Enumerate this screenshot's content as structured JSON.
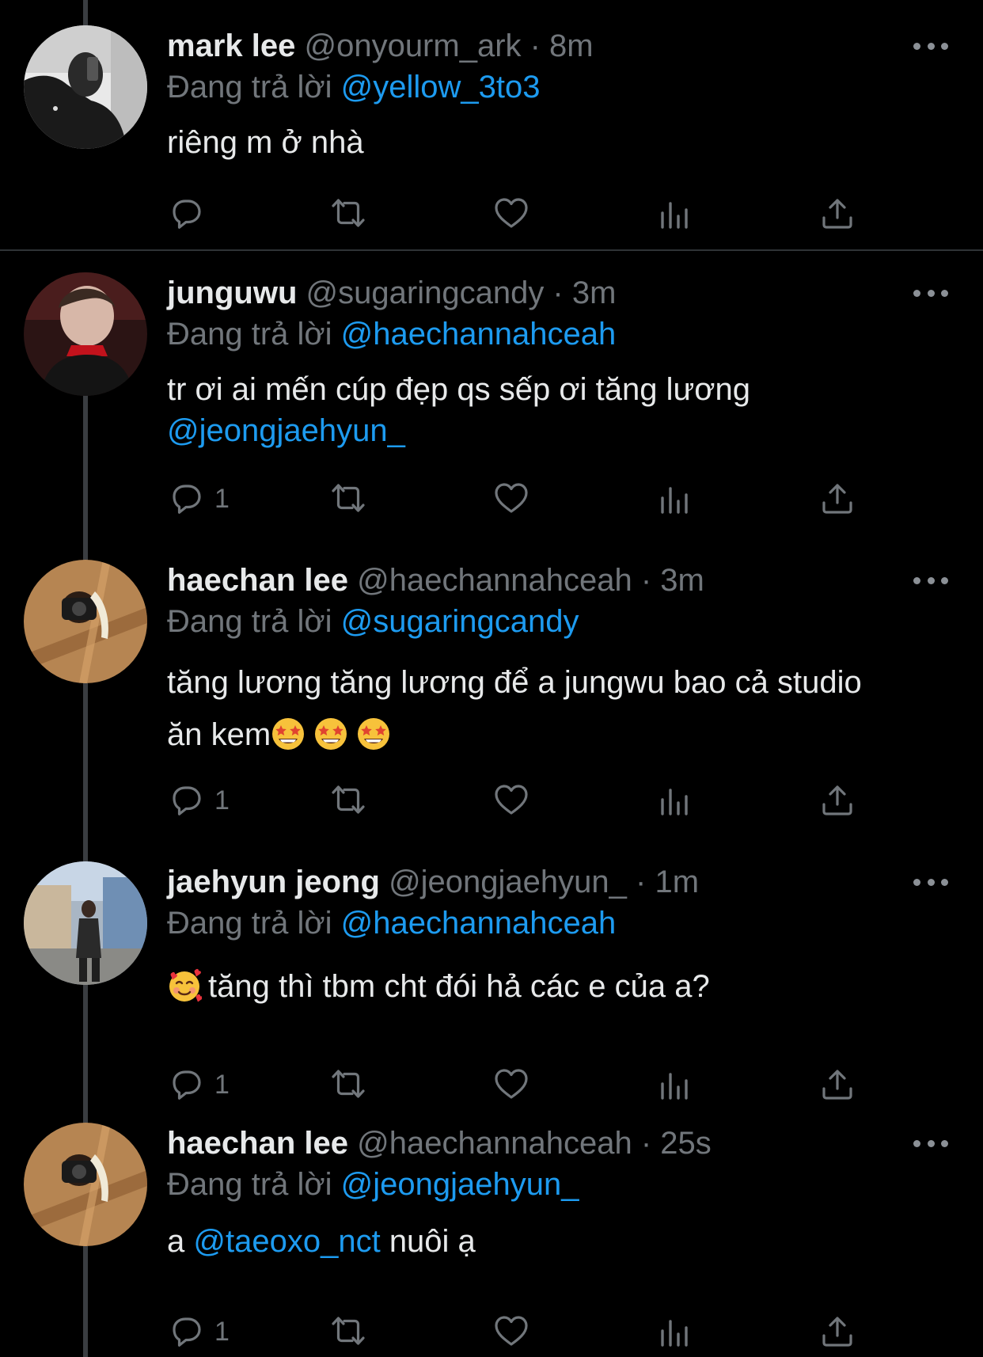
{
  "reply_prefix": "Đang trả lời",
  "tweets": [
    {
      "name": "mark lee",
      "meta": "@onyourm_ark · 8m",
      "replying_to": "@yellow_3to3",
      "text_line1": "riêng m ở nhà",
      "reply_count": ""
    },
    {
      "name": "junguwu",
      "meta": "@sugaringcandy · 3m",
      "replying_to": "@haechannahceah",
      "text_line1": "tr ơi ai mến cúp đẹp qs sếp ơi tăng lương",
      "text_mention": "@jeongjaehyun_",
      "reply_count": "1"
    },
    {
      "name": "haechan lee",
      "meta": "@haechannahceah · 3m",
      "replying_to": "@sugaringcandy",
      "text_line1": "tăng lương tăng lương để a jungwu bao cả studio",
      "text_line2": "ăn kem",
      "emoji": "star-struck-emoji",
      "reply_count": "1"
    },
    {
      "name": "jaehyun jeong",
      "meta": "@jeongjaehyun_ · 1m",
      "replying_to": "@haechannahceah",
      "emoji": "smiling-face-with-hearts-emoji",
      "text_line1": "tăng thì tbm cht đói hả các e của a?",
      "reply_count": "1"
    },
    {
      "name": "haechan lee",
      "meta": "@haechannahceah · 25s",
      "replying_to": "@jeongjaehyun_",
      "text_pre": "a",
      "text_mention": "@taeoxo_nct",
      "text_post": "nuôi ạ",
      "reply_count": "1"
    }
  ],
  "icons": [
    "reply-icon",
    "retweet-icon",
    "like-icon",
    "views-icon",
    "share-icon",
    "more-icon"
  ],
  "colors": {
    "background": "#000000",
    "text": "#e7e9ea",
    "muted": "#71767b",
    "link": "#1d9bf0",
    "thread_line": "#3a3d41"
  }
}
